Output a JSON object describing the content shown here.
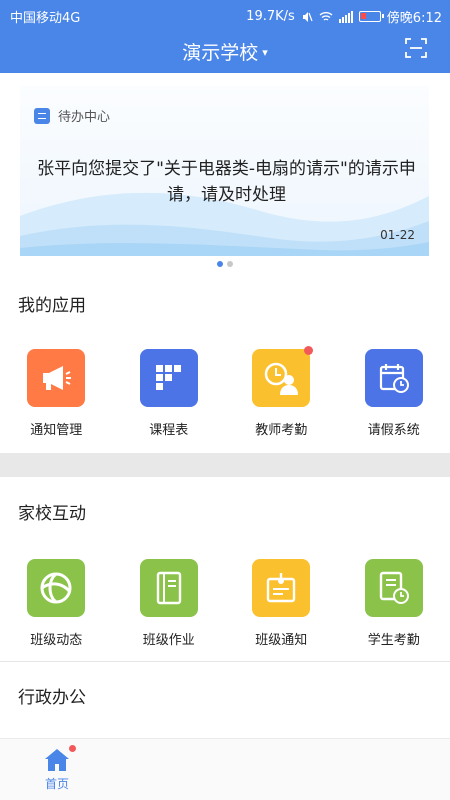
{
  "status_bar": {
    "carrier": "中国移动4G",
    "speed": "19.7K/s",
    "network": "4G",
    "time": "傍晚6:12"
  },
  "header": {
    "title": "演示学校",
    "caret": "▾",
    "scan_icon": "scan-icon"
  },
  "banner": {
    "section_label": "待办中心",
    "message": "张平向您提交了\"关于电器类-电扇的请示\"的请示申请，请及时处理",
    "date": "01-22",
    "pages": 2,
    "active_page": 1
  },
  "sections": {
    "my_apps": {
      "title": "我的应用",
      "items": [
        {
          "label": "通知管理",
          "icon": "megaphone-icon",
          "color": "#ff7a45"
        },
        {
          "label": "课程表",
          "icon": "timetable-icon",
          "color": "#4d74e6"
        },
        {
          "label": "教师考勤",
          "icon": "clock-person-icon",
          "color": "#fbc02d",
          "badge": true
        },
        {
          "label": "请假系统",
          "icon": "calendar-clock-icon",
          "color": "#4d74e6"
        }
      ]
    },
    "home_school": {
      "title": "家校互动",
      "items": [
        {
          "label": "班级动态",
          "icon": "swirl-icon",
          "color": "#8bc34a"
        },
        {
          "label": "班级作业",
          "icon": "notebook-icon",
          "color": "#8bc34a"
        },
        {
          "label": "班级通知",
          "icon": "badge-icon",
          "color": "#fbc02d"
        },
        {
          "label": "学生考勤",
          "icon": "doc-clock-icon",
          "color": "#8bc34a"
        }
      ]
    },
    "admin": {
      "title": "行政办公"
    }
  },
  "bottom_nav": {
    "home_label": "首页",
    "home_icon": "home-icon",
    "accent": "#4a86e8"
  }
}
